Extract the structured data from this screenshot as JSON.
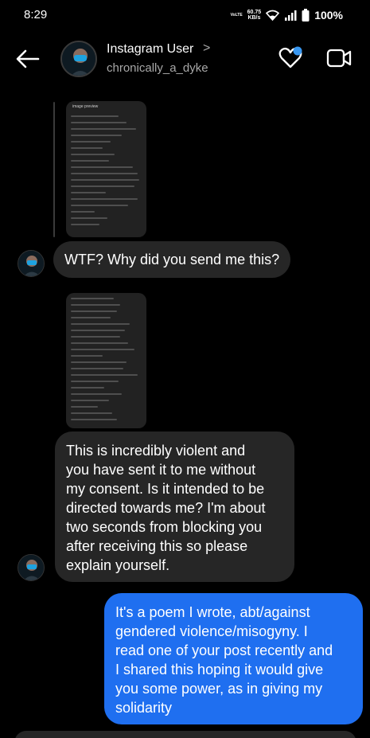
{
  "status_bar": {
    "time": "8:29",
    "network_label_1": "VoLTE",
    "speed_value": "60.75",
    "speed_unit": "KB/s",
    "battery": "100%"
  },
  "header": {
    "name": "Instagram User",
    "handle": "chronically_a_dyke",
    "chevron": ">"
  },
  "shared_image_1": {
    "label": "image preview"
  },
  "messages": [
    {
      "text": "WTF? Why did you send me this?"
    },
    {
      "text": "This is incredibly violent and\nyou have sent it to me without\nmy consent. Is it intended to be\ndirected towards me? I'm about\ntwo seconds from blocking you\nafter receiving this so please\nexplain yourself."
    },
    {
      "text": "It's a poem I wrote, abt/against\ngendered violence/misogyny. I\nread one of your post recently and\nI shared this hoping it would give\nyou some power, as in giving my\nsolidarity"
    }
  ],
  "colors": {
    "background": "#000000",
    "incoming_bubble": "#262626",
    "outgoing_bubble": "#1f6ff0",
    "notification_dot": "#3897f0"
  }
}
